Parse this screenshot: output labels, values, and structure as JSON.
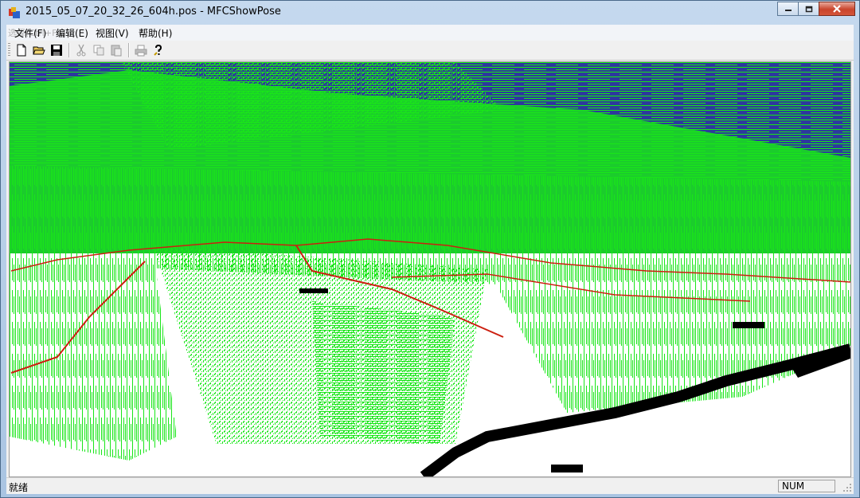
{
  "window": {
    "title": "2015_05_07_20_32_26_604h.pos - MFCShowPose"
  },
  "menu": {
    "ghost_text": "选择(Ctrl+F1)",
    "items": [
      {
        "label": "文件(F)"
      },
      {
        "label": "编辑(E)"
      },
      {
        "label": "视图(V)"
      },
      {
        "label": "帮助(H)"
      }
    ]
  },
  "toolbar": {
    "buttons": [
      {
        "icon": "new-file-icon",
        "enabled": true
      },
      {
        "icon": "open-folder-icon",
        "enabled": true
      },
      {
        "icon": "save-icon",
        "enabled": true
      },
      {
        "icon": "cut-icon",
        "enabled": false
      },
      {
        "icon": "copy-icon",
        "enabled": false
      },
      {
        "icon": "paste-icon",
        "enabled": false
      },
      {
        "icon": "print-icon",
        "enabled": false
      },
      {
        "icon": "help-icon",
        "enabled": true
      }
    ]
  },
  "viewport": {
    "sky_color": "#2c3a9c",
    "point_color": "#19e619",
    "trajectory_color": "#cc1f0f",
    "ground_color": "#ffffff",
    "map_dark_color": "#000000"
  },
  "status": {
    "ready_text": "就绪",
    "num_indicator": "NUM"
  }
}
